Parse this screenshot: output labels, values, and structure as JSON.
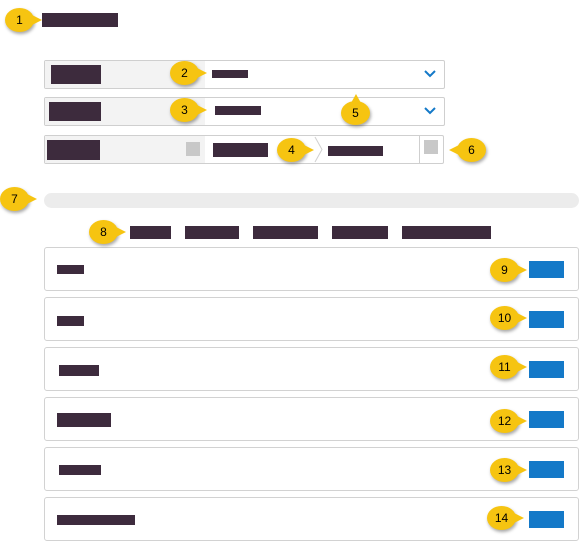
{
  "callouts": [
    "1",
    "2",
    "3",
    "4",
    "5",
    "6",
    "7",
    "8",
    "9",
    "10",
    "11",
    "12",
    "13",
    "14"
  ],
  "icons": {
    "dropdown": "chevron-down-icon"
  },
  "colors": {
    "accent": "#1479c8",
    "callout": "#f6c411",
    "redaction": "#3d2b3d"
  }
}
